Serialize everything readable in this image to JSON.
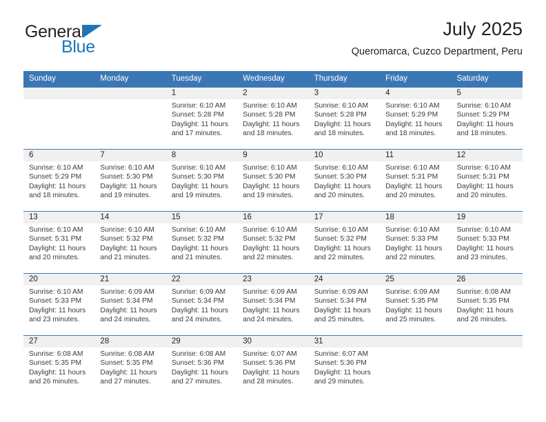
{
  "brand": {
    "name_top": "General",
    "name_bottom": "Blue",
    "triangle_color": "#1b75bb"
  },
  "header": {
    "title": "July 2025",
    "subtitle": "Queromarca, Cuzco Department, Peru"
  },
  "theme": {
    "header_blue": "#3b77b5",
    "daynum_bg": "#f0f0f0",
    "text": "#231f20"
  },
  "calendar": {
    "weekday_headers": [
      "Sunday",
      "Monday",
      "Tuesday",
      "Wednesday",
      "Thursday",
      "Friday",
      "Saturday"
    ],
    "weeks": [
      [
        {
          "day": "",
          "sunrise": "",
          "sunset": "",
          "daylight": "",
          "empty": true
        },
        {
          "day": "",
          "sunrise": "",
          "sunset": "",
          "daylight": "",
          "empty": true
        },
        {
          "day": "1",
          "sunrise": "Sunrise: 6:10 AM",
          "sunset": "Sunset: 5:28 PM",
          "daylight": "Daylight: 11 hours and 17 minutes."
        },
        {
          "day": "2",
          "sunrise": "Sunrise: 6:10 AM",
          "sunset": "Sunset: 5:28 PM",
          "daylight": "Daylight: 11 hours and 18 minutes."
        },
        {
          "day": "3",
          "sunrise": "Sunrise: 6:10 AM",
          "sunset": "Sunset: 5:28 PM",
          "daylight": "Daylight: 11 hours and 18 minutes."
        },
        {
          "day": "4",
          "sunrise": "Sunrise: 6:10 AM",
          "sunset": "Sunset: 5:29 PM",
          "daylight": "Daylight: 11 hours and 18 minutes."
        },
        {
          "day": "5",
          "sunrise": "Sunrise: 6:10 AM",
          "sunset": "Sunset: 5:29 PM",
          "daylight": "Daylight: 11 hours and 18 minutes."
        }
      ],
      [
        {
          "day": "6",
          "sunrise": "Sunrise: 6:10 AM",
          "sunset": "Sunset: 5:29 PM",
          "daylight": "Daylight: 11 hours and 18 minutes."
        },
        {
          "day": "7",
          "sunrise": "Sunrise: 6:10 AM",
          "sunset": "Sunset: 5:30 PM",
          "daylight": "Daylight: 11 hours and 19 minutes."
        },
        {
          "day": "8",
          "sunrise": "Sunrise: 6:10 AM",
          "sunset": "Sunset: 5:30 PM",
          "daylight": "Daylight: 11 hours and 19 minutes."
        },
        {
          "day": "9",
          "sunrise": "Sunrise: 6:10 AM",
          "sunset": "Sunset: 5:30 PM",
          "daylight": "Daylight: 11 hours and 19 minutes."
        },
        {
          "day": "10",
          "sunrise": "Sunrise: 6:10 AM",
          "sunset": "Sunset: 5:30 PM",
          "daylight": "Daylight: 11 hours and 20 minutes."
        },
        {
          "day": "11",
          "sunrise": "Sunrise: 6:10 AM",
          "sunset": "Sunset: 5:31 PM",
          "daylight": "Daylight: 11 hours and 20 minutes."
        },
        {
          "day": "12",
          "sunrise": "Sunrise: 6:10 AM",
          "sunset": "Sunset: 5:31 PM",
          "daylight": "Daylight: 11 hours and 20 minutes."
        }
      ],
      [
        {
          "day": "13",
          "sunrise": "Sunrise: 6:10 AM",
          "sunset": "Sunset: 5:31 PM",
          "daylight": "Daylight: 11 hours and 20 minutes."
        },
        {
          "day": "14",
          "sunrise": "Sunrise: 6:10 AM",
          "sunset": "Sunset: 5:32 PM",
          "daylight": "Daylight: 11 hours and 21 minutes."
        },
        {
          "day": "15",
          "sunrise": "Sunrise: 6:10 AM",
          "sunset": "Sunset: 5:32 PM",
          "daylight": "Daylight: 11 hours and 21 minutes."
        },
        {
          "day": "16",
          "sunrise": "Sunrise: 6:10 AM",
          "sunset": "Sunset: 5:32 PM",
          "daylight": "Daylight: 11 hours and 22 minutes."
        },
        {
          "day": "17",
          "sunrise": "Sunrise: 6:10 AM",
          "sunset": "Sunset: 5:32 PM",
          "daylight": "Daylight: 11 hours and 22 minutes."
        },
        {
          "day": "18",
          "sunrise": "Sunrise: 6:10 AM",
          "sunset": "Sunset: 5:33 PM",
          "daylight": "Daylight: 11 hours and 22 minutes."
        },
        {
          "day": "19",
          "sunrise": "Sunrise: 6:10 AM",
          "sunset": "Sunset: 5:33 PM",
          "daylight": "Daylight: 11 hours and 23 minutes."
        }
      ],
      [
        {
          "day": "20",
          "sunrise": "Sunrise: 6:10 AM",
          "sunset": "Sunset: 5:33 PM",
          "daylight": "Daylight: 11 hours and 23 minutes."
        },
        {
          "day": "21",
          "sunrise": "Sunrise: 6:09 AM",
          "sunset": "Sunset: 5:34 PM",
          "daylight": "Daylight: 11 hours and 24 minutes."
        },
        {
          "day": "22",
          "sunrise": "Sunrise: 6:09 AM",
          "sunset": "Sunset: 5:34 PM",
          "daylight": "Daylight: 11 hours and 24 minutes."
        },
        {
          "day": "23",
          "sunrise": "Sunrise: 6:09 AM",
          "sunset": "Sunset: 5:34 PM",
          "daylight": "Daylight: 11 hours and 24 minutes."
        },
        {
          "day": "24",
          "sunrise": "Sunrise: 6:09 AM",
          "sunset": "Sunset: 5:34 PM",
          "daylight": "Daylight: 11 hours and 25 minutes."
        },
        {
          "day": "25",
          "sunrise": "Sunrise: 6:09 AM",
          "sunset": "Sunset: 5:35 PM",
          "daylight": "Daylight: 11 hours and 25 minutes."
        },
        {
          "day": "26",
          "sunrise": "Sunrise: 6:08 AM",
          "sunset": "Sunset: 5:35 PM",
          "daylight": "Daylight: 11 hours and 26 minutes."
        }
      ],
      [
        {
          "day": "27",
          "sunrise": "Sunrise: 6:08 AM",
          "sunset": "Sunset: 5:35 PM",
          "daylight": "Daylight: 11 hours and 26 minutes."
        },
        {
          "day": "28",
          "sunrise": "Sunrise: 6:08 AM",
          "sunset": "Sunset: 5:35 PM",
          "daylight": "Daylight: 11 hours and 27 minutes."
        },
        {
          "day": "29",
          "sunrise": "Sunrise: 6:08 AM",
          "sunset": "Sunset: 5:36 PM",
          "daylight": "Daylight: 11 hours and 27 minutes."
        },
        {
          "day": "30",
          "sunrise": "Sunrise: 6:07 AM",
          "sunset": "Sunset: 5:36 PM",
          "daylight": "Daylight: 11 hours and 28 minutes."
        },
        {
          "day": "31",
          "sunrise": "Sunrise: 6:07 AM",
          "sunset": "Sunset: 5:36 PM",
          "daylight": "Daylight: 11 hours and 29 minutes."
        },
        {
          "day": "",
          "sunrise": "",
          "sunset": "",
          "daylight": "",
          "empty": true
        },
        {
          "day": "",
          "sunrise": "",
          "sunset": "",
          "daylight": "",
          "empty": true
        }
      ]
    ]
  }
}
